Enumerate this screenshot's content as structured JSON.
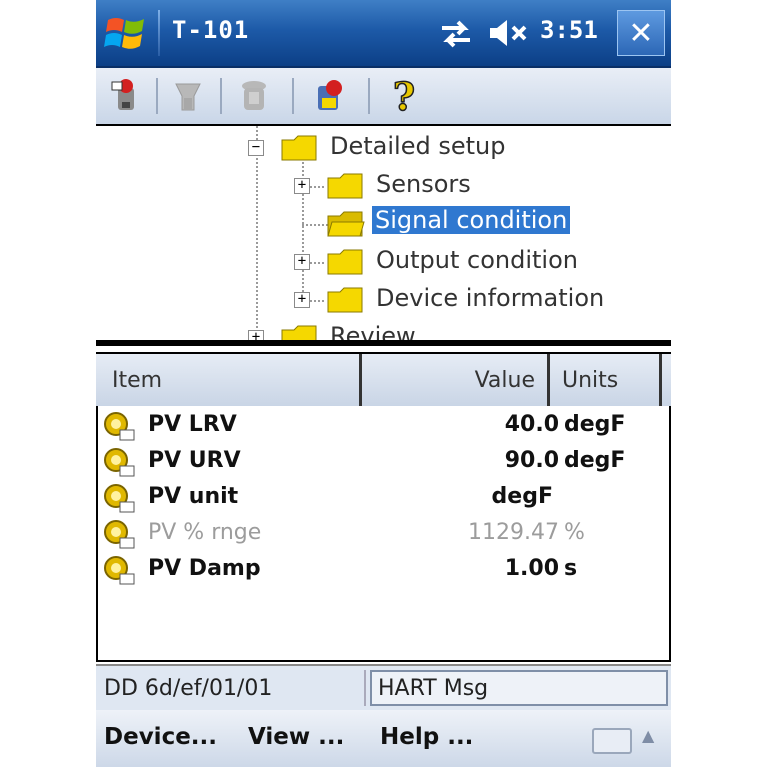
{
  "window": {
    "title": "T-101",
    "clock": "3:51",
    "close_label": "✕"
  },
  "toolbar": {
    "buttons": [
      "device-online-icon",
      "tag-disabled-icon",
      "tag-disabled-2-icon",
      "device-settings-icon",
      "help-icon"
    ],
    "help_label": "?"
  },
  "tree": {
    "items": [
      {
        "label": "Detailed setup",
        "expander": "−",
        "open": true
      },
      {
        "label": "Sensors",
        "expander": "+"
      },
      {
        "label": "Signal condition",
        "selected": true
      },
      {
        "label": "Output condition",
        "expander": "+"
      },
      {
        "label": "Device information",
        "expander": "+"
      },
      {
        "label": "Review",
        "expander": "+"
      }
    ]
  },
  "list": {
    "columns": {
      "item": "Item",
      "value": "Value",
      "units": "Units"
    },
    "rows": [
      {
        "name": "PV LRV",
        "value": "40.0",
        "units": "degF"
      },
      {
        "name": "PV URV",
        "value": "90.0",
        "units": "degF"
      },
      {
        "name": "PV unit",
        "value": "degF",
        "units": ""
      },
      {
        "name": "PV % rnge",
        "value": "1129.47",
        "units": "%",
        "dim": true
      },
      {
        "name": "PV Damp",
        "value": "1.00",
        "units": "s"
      }
    ]
  },
  "status": {
    "left": "DD 6d/ef/01/01",
    "right": "HART Msg"
  },
  "menu": {
    "device": "Device...",
    "view": "View ...",
    "help": "Help ..."
  },
  "colors": {
    "titlebar": "#1d5aa8",
    "selection": "#2f78d0",
    "folder": "#f5d800"
  }
}
